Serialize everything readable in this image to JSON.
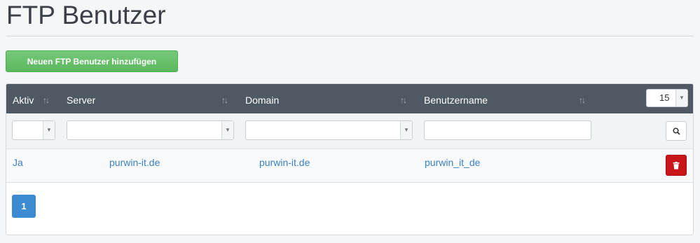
{
  "page": {
    "title": "FTP Benutzer"
  },
  "toolbar": {
    "add_label": "Neuen FTP Benutzer hinzufügen"
  },
  "table": {
    "columns": [
      {
        "label": "Aktiv"
      },
      {
        "label": "Server"
      },
      {
        "label": "Domain"
      },
      {
        "label": "Benutzername"
      }
    ],
    "page_size": "15",
    "rows": [
      {
        "aktiv": "Ja",
        "server": "purwin-it.de",
        "domain": "purwin-it.de",
        "benutzername": "purwin_it_de"
      }
    ]
  },
  "filters": {
    "aktiv": "",
    "server": "",
    "domain": "",
    "benutzername": ""
  },
  "pagination": {
    "current": "1"
  },
  "colors": {
    "header_bg": "#4e5964",
    "add_button": "#5cb85c",
    "delete_button": "#c9141a",
    "link": "#3a82c1",
    "page_active": "#3c8ad0"
  },
  "icons": {
    "sort": "sort-icon",
    "search": "search-icon",
    "delete": "trash-icon",
    "dropdown": "chevron-down-icon"
  }
}
